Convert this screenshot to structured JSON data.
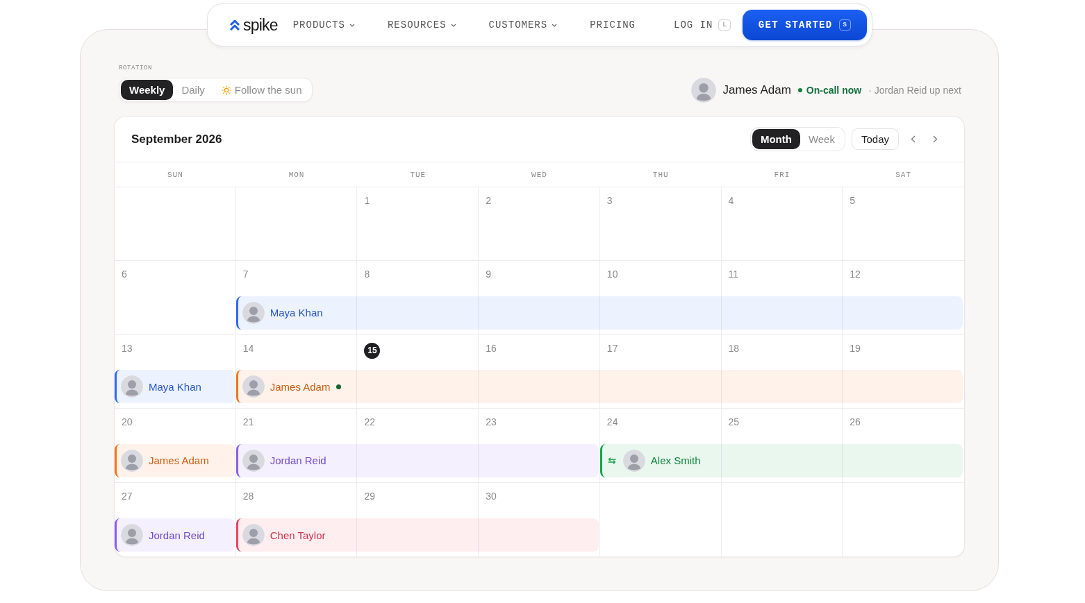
{
  "nav": {
    "logo": "spike",
    "items": [
      {
        "label": "PRODUCTS",
        "dropdown": true
      },
      {
        "label": "RESOURCES",
        "dropdown": true
      },
      {
        "label": "CUSTOMERS",
        "dropdown": true
      },
      {
        "label": "PRICING",
        "dropdown": false
      }
    ],
    "login": {
      "label": "LOG IN",
      "shortcut": "L"
    },
    "cta": {
      "label": "GET STARTED",
      "shortcut": "S"
    }
  },
  "rotation": {
    "label": "ROTATION",
    "options": [
      {
        "label": "Weekly",
        "selected": true,
        "kind": "plain"
      },
      {
        "label": "Daily",
        "selected": false,
        "kind": "plain"
      },
      {
        "label": "Follow the sun",
        "selected": false,
        "kind": "sun"
      }
    ]
  },
  "on_call": {
    "name": "James Adam",
    "status": "On-call now",
    "next": "· Jordan Reid up next"
  },
  "calendar": {
    "title": "September 2026",
    "views": [
      {
        "label": "Month",
        "selected": true
      },
      {
        "label": "Week",
        "selected": false
      }
    ],
    "today_button": "Today",
    "weekdays": [
      "SUN",
      "MON",
      "TUE",
      "WED",
      "THU",
      "FRI",
      "SAT"
    ],
    "weeks": [
      {
        "days": [
          {
            "kind": "blank"
          },
          {
            "kind": "blank"
          },
          {
            "kind": "date",
            "date": "1",
            "today": false
          },
          {
            "kind": "date",
            "date": "2",
            "today": false
          },
          {
            "kind": "date",
            "date": "3",
            "today": false
          },
          {
            "kind": "date",
            "date": "4",
            "today": false
          },
          {
            "kind": "date",
            "date": "5",
            "today": false
          }
        ]
      },
      {
        "days": [
          {
            "kind": "date",
            "date": "6",
            "today": false
          },
          {
            "kind": "date",
            "date": "7",
            "today": false,
            "shift": {
              "name": "Maya Khan",
              "color": "#2f6bf0",
              "on_call": false,
              "swap": false
            }
          },
          {
            "kind": "date",
            "date": "8",
            "today": false
          },
          {
            "kind": "date",
            "date": "9",
            "today": false
          },
          {
            "kind": "date",
            "date": "10",
            "today": false
          },
          {
            "kind": "date",
            "date": "11",
            "today": false
          },
          {
            "kind": "date",
            "date": "12",
            "today": false
          }
        ]
      },
      {
        "days": [
          {
            "kind": "date",
            "date": "13",
            "today": false,
            "shift": {
              "name": "Maya Khan",
              "color": "#2f6bf0",
              "on_call": false,
              "swap": false
            }
          },
          {
            "kind": "date",
            "date": "14",
            "today": false,
            "shift": {
              "name": "James Adam",
              "color": "#f97316",
              "on_call": true,
              "swap": false
            }
          },
          {
            "kind": "date",
            "date": "15",
            "today": true
          },
          {
            "kind": "date",
            "date": "16",
            "today": false
          },
          {
            "kind": "date",
            "date": "17",
            "today": false
          },
          {
            "kind": "date",
            "date": "18",
            "today": false
          },
          {
            "kind": "date",
            "date": "19",
            "today": false
          }
        ]
      },
      {
        "days": [
          {
            "kind": "date",
            "date": "20",
            "today": false,
            "shift": {
              "name": "James Adam",
              "color": "#f97316",
              "on_call": false,
              "swap": false
            }
          },
          {
            "kind": "date",
            "date": "21",
            "today": false,
            "shift": {
              "name": "Jordan Reid",
              "color": "#8b5cf6",
              "on_call": false,
              "swap": false
            }
          },
          {
            "kind": "date",
            "date": "22",
            "today": false
          },
          {
            "kind": "date",
            "date": "23",
            "today": false
          },
          {
            "kind": "date",
            "date": "24",
            "today": false,
            "shift": {
              "name": "Alex Smith",
              "color": "#16a34a",
              "on_call": false,
              "swap": true
            }
          },
          {
            "kind": "date",
            "date": "25",
            "today": false
          },
          {
            "kind": "date",
            "date": "26",
            "today": false
          }
        ]
      },
      {
        "days": [
          {
            "kind": "date",
            "date": "27",
            "today": false,
            "shift": {
              "name": "Jordan Reid",
              "color": "#8b5cf6",
              "on_call": false,
              "swap": false
            }
          },
          {
            "kind": "date",
            "date": "28",
            "today": false,
            "shift": {
              "name": "Chen Taylor",
              "color": "#f43f5e",
              "on_call": false,
              "swap": false
            }
          },
          {
            "kind": "date",
            "date": "29",
            "today": false
          },
          {
            "kind": "date",
            "date": "30",
            "today": false
          },
          {
            "kind": "blank"
          },
          {
            "kind": "blank"
          },
          {
            "kind": "blank"
          }
        ]
      }
    ]
  }
}
